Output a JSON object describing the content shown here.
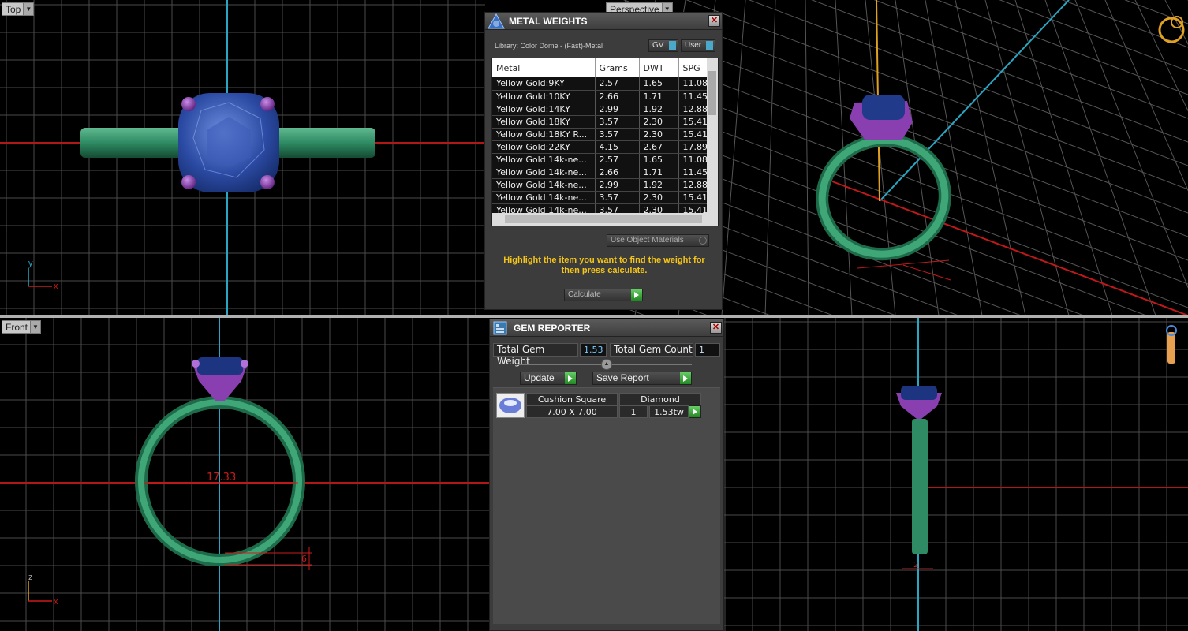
{
  "viewports": {
    "top": {
      "label": "Top",
      "axis_v": "y",
      "axis_h": "x"
    },
    "perspective": {
      "label": "Perspective"
    },
    "front": {
      "label": "Front",
      "axis_v": "z",
      "axis_h": "x",
      "dimension": "17.33",
      "dim_small": "6"
    },
    "side": {
      "dim_small": "2"
    }
  },
  "metal_weights": {
    "title": "METAL WEIGHTS",
    "library": "Library: Color Dome - (Fast)-Metal",
    "gv_label": "GV",
    "user_label": "User",
    "columns": [
      "Metal",
      "Grams",
      "DWT",
      "SPG"
    ],
    "rows": [
      [
        "Yellow Gold:9KY",
        "2.57",
        "1.65",
        "11.08"
      ],
      [
        "Yellow Gold:10KY",
        "2.66",
        "1.71",
        "11.45"
      ],
      [
        "Yellow Gold:14KY",
        "2.99",
        "1.92",
        "12.88"
      ],
      [
        "Yellow Gold:18KY",
        "3.57",
        "2.30",
        "15.41"
      ],
      [
        "Yellow Gold:18KY R...",
        "3.57",
        "2.30",
        "15.41"
      ],
      [
        "Yellow Gold:22KY",
        "4.15",
        "2.67",
        "17.89"
      ],
      [
        "Yellow Gold 14k-ne...",
        "2.57",
        "1.65",
        "11.08"
      ],
      [
        "Yellow Gold 14k-ne...",
        "2.66",
        "1.71",
        "11.45"
      ],
      [
        "Yellow Gold 14k-ne...",
        "2.99",
        "1.92",
        "12.88"
      ],
      [
        "Yellow Gold 14k-ne...",
        "3.57",
        "2.30",
        "15.41"
      ],
      [
        "Yellow Gold 14k-ne...",
        "3.57",
        "2.30",
        "15.41"
      ]
    ],
    "use_object_materials": "Use Object Materials",
    "hint": "Highlight the item you want to find the weight for then press calculate.",
    "calculate_label": "Calculate"
  },
  "gem_reporter": {
    "title": "GEM REPORTER",
    "total_weight_label": "Total Gem Weight",
    "total_weight_value": "1.53",
    "total_count_label": "Total Gem Count",
    "total_count_value": "1",
    "update_label": "Update",
    "save_report_label": "Save Report",
    "gem": {
      "cut": "Cushion Square",
      "type": "Diamond",
      "size": "7.00 X 7.00",
      "count": "1",
      "weight": "1.53tw"
    }
  },
  "colors": {
    "ring": "#2e8b63",
    "prong": "#8a3fb0",
    "stone": "#2b4aa3",
    "grid": "#5a5a5a",
    "axis_red": "#cc1a1a",
    "axis_cyan": "#2aa6c2",
    "hint_yellow": "#f5c518"
  },
  "icons": [
    "metal-weights-icon",
    "gem-reporter-icon",
    "close-icon",
    "ring-navigator-icon",
    "pen-tool-icon",
    "dropdown-arrow-icon"
  ]
}
